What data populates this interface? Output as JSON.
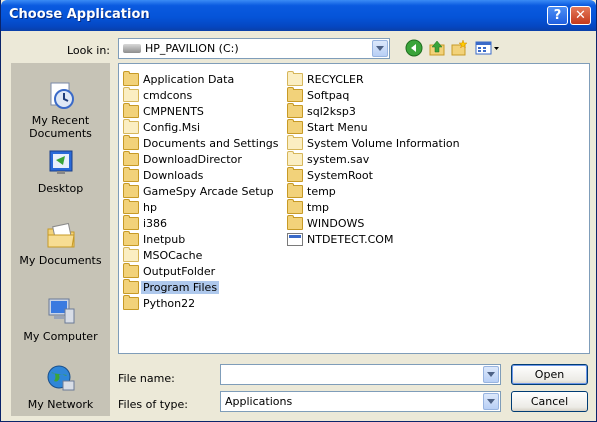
{
  "window": {
    "title": "Choose Application",
    "help_glyph": "?",
    "close_glyph": "✕"
  },
  "lookin": {
    "label": "Look in:",
    "value": "HP_PAVILION (C:)"
  },
  "toolbar": {
    "back_icon": "back-arrow-icon",
    "up_icon": "up-folder-icon",
    "new_folder_icon": "new-folder-icon",
    "views_icon": "views-menu-icon"
  },
  "places": [
    {
      "label": "My Recent Documents",
      "icon": "recent-documents-icon"
    },
    {
      "label": "Desktop",
      "icon": "desktop-icon"
    },
    {
      "label": "My Documents",
      "icon": "my-documents-icon"
    },
    {
      "label": "My Computer",
      "icon": "my-computer-icon"
    },
    {
      "label": "My Network",
      "icon": "my-network-icon"
    }
  ],
  "files": [
    {
      "name": "Application Data",
      "type": "folder"
    },
    {
      "name": "cmdcons",
      "type": "folder-hidden"
    },
    {
      "name": "CMPNENTS",
      "type": "folder"
    },
    {
      "name": "Config.Msi",
      "type": "folder-hidden"
    },
    {
      "name": "Documents and Settings",
      "type": "folder"
    },
    {
      "name": "DownloadDirector",
      "type": "folder"
    },
    {
      "name": "Downloads",
      "type": "folder"
    },
    {
      "name": "GameSpy Arcade Setup",
      "type": "folder"
    },
    {
      "name": "hp",
      "type": "folder"
    },
    {
      "name": "i386",
      "type": "folder"
    },
    {
      "name": "Inetpub",
      "type": "folder"
    },
    {
      "name": "MSOCache",
      "type": "folder-hidden"
    },
    {
      "name": "OutputFolder",
      "type": "folder"
    },
    {
      "name": "Program Files",
      "type": "folder",
      "selected": true
    },
    {
      "name": "Python22",
      "type": "folder"
    },
    {
      "name": "RECYCLER",
      "type": "folder-hidden"
    },
    {
      "name": "Softpaq",
      "type": "folder"
    },
    {
      "name": "sql2ksp3",
      "type": "folder"
    },
    {
      "name": "Start Menu",
      "type": "folder"
    },
    {
      "name": "System Volume Information",
      "type": "folder-hidden"
    },
    {
      "name": "system.sav",
      "type": "folder-hidden"
    },
    {
      "name": "SystemRoot",
      "type": "folder"
    },
    {
      "name": "temp",
      "type": "folder"
    },
    {
      "name": "tmp",
      "type": "folder"
    },
    {
      "name": "WINDOWS",
      "type": "folder"
    },
    {
      "name": "NTDETECT.COM",
      "type": "file"
    }
  ],
  "filename": {
    "label": "File name:",
    "value": ""
  },
  "filetype": {
    "label": "Files of type:",
    "value": "Applications"
  },
  "buttons": {
    "open": "Open",
    "cancel": "Cancel"
  }
}
